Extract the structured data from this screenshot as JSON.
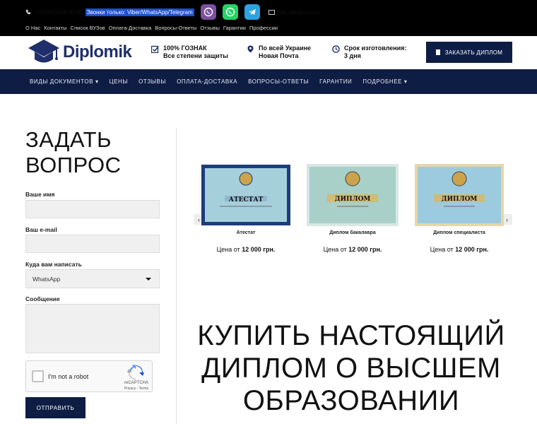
{
  "topbar": {
    "phone": "+38(050)408-35-60",
    "calls_note": "Звонки только: Viber/WhatsApp/Telegram",
    "email": "Без предоплаты",
    "links": [
      "О Нас",
      "Контакты",
      "Список ВУЗов",
      "Оплата-Доставка",
      "Вопросы-Ответы",
      "Отзывы",
      "Гарантии",
      "Профессии"
    ]
  },
  "header": {
    "logo_text": "Diplomik",
    "features": [
      {
        "line1": "100% ГОЗНАК",
        "line2": "Все степени защиты"
      },
      {
        "line1": "По всей Украине",
        "line2": "Новая Почта"
      },
      {
        "line1": "Срок изготовления:",
        "line2": "3 дня"
      }
    ],
    "order_button": "ЗАКАЗАТЬ ДИПЛОМ"
  },
  "nav": {
    "items": [
      "ВИДЫ ДОКУМЕНТОВ ▾",
      "ЦЕНЫ",
      "ОТЗЫВЫ",
      "ОПЛАТА-ДОСТАВКА",
      "ВОПРОСЫ-ОТВЕТЫ",
      "ГАРАНТИИ",
      "ПОДРОБНЕЕ ▾"
    ]
  },
  "form": {
    "title_line1": "ЗАДАТЬ",
    "title_line2": "ВОПРОС",
    "name_label": "Ваше имя",
    "email_label": "Ваш e-mail",
    "channel_label": "Куда вам написать",
    "channel_value": "WhatsApp",
    "message_label": "Сообщение",
    "captcha_text": "I'm not a robot",
    "captcha_brand": "reCAPTCHA",
    "captcha_links": "Privacy - Terms",
    "submit": "ОТПРАВИТЬ"
  },
  "carousel": {
    "prev": "‹",
    "next": "›",
    "items": [
      {
        "caption": "Атестат",
        "price_prefix": "Цена от",
        "price": "12 000 грн.",
        "doc_word": "АТЕСТАТ",
        "color": "#9fc8d8",
        "border": "#1c3d7a"
      },
      {
        "caption": "Диплом бакалавра",
        "price_prefix": "Цена от",
        "price": "12 000 грн.",
        "doc_word": "ДИПЛОМ",
        "color": "#a9cfd0",
        "border": "#d9e6e4"
      },
      {
        "caption": "Диплом специалиста",
        "price_prefix": "Цена от",
        "price": "12 000 грн.",
        "doc_word": "ДИПЛОМ",
        "color": "#9ccbe0",
        "border": "#e6d6a8"
      }
    ]
  },
  "headline": {
    "line1": "КУПИТЬ НАСТОЯЩИЙ",
    "line2": "ДИПЛОМ О ВЫСШЕМ",
    "line3": "ОБРАЗОВАНИИ"
  }
}
